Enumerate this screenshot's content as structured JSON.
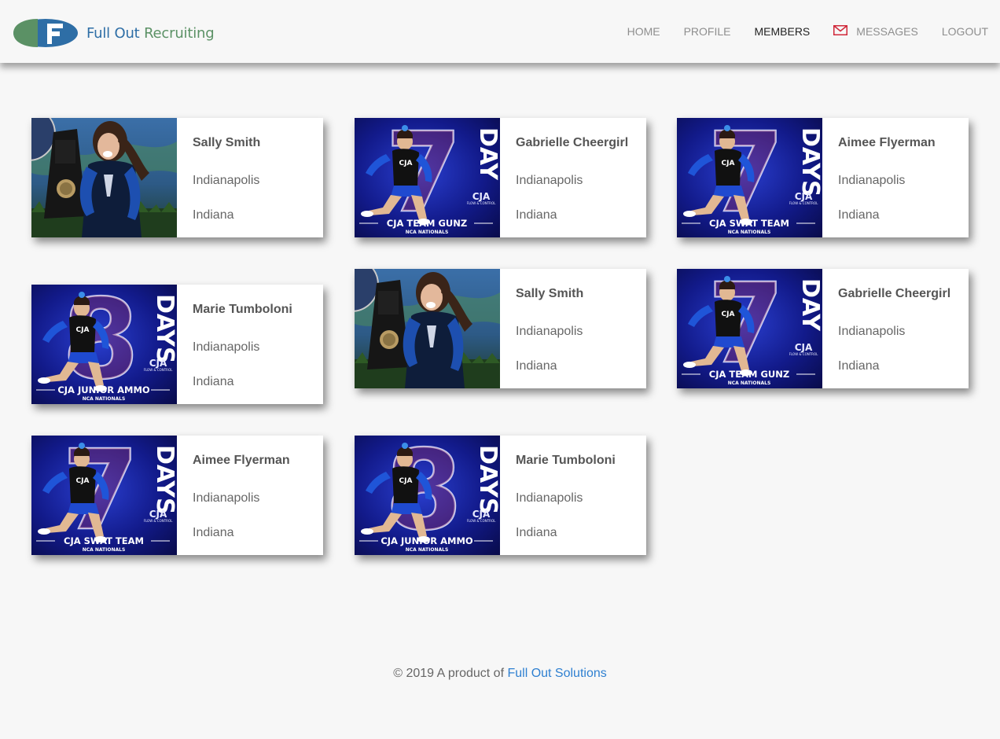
{
  "brand": {
    "name_part1": "Full Out ",
    "name_part2": "Recruiting",
    "colors": {
      "blue": "#2e6ea6",
      "green": "#5b9165"
    }
  },
  "nav": {
    "items": [
      {
        "label": "HOME",
        "active": false
      },
      {
        "label": "PROFILE",
        "active": false
      },
      {
        "label": "MEMBERS",
        "active": true
      },
      {
        "label": "MESSAGES",
        "active": false,
        "icon": "mail-icon"
      },
      {
        "label": "LOGOUT",
        "active": false
      }
    ]
  },
  "members": [
    {
      "name": "Sally Smith",
      "city": "Indianapolis",
      "state": "Indiana",
      "photo": "trophy"
    },
    {
      "name": "Gabrielle Cheergirl",
      "city": "Indianapolis",
      "state": "Indiana",
      "photo": "gunz",
      "banner_big": "DAY",
      "banner_team": "CJA TEAM GUNZ",
      "banner_sub": "NCA NATIONALS"
    },
    {
      "name": "Aimee Flyerman",
      "city": "Indianapolis",
      "state": "Indiana",
      "photo": "swat",
      "banner_big": "DAYS",
      "banner_team": "CJA SWAT TEAM",
      "banner_sub": "NCA NATIONALS"
    },
    {
      "name": "Marie Tumboloni",
      "city": "Indianapolis",
      "state": "Indiana",
      "photo": "ammo",
      "banner_big": "DAYS",
      "banner_team": "CJA JUNIOR AMMO",
      "banner_sub": "NCA NATIONALS"
    },
    {
      "name": "Sally Smith",
      "city": "Indianapolis",
      "state": "Indiana",
      "photo": "trophy"
    },
    {
      "name": "Gabrielle Cheergirl",
      "city": "Indianapolis",
      "state": "Indiana",
      "photo": "gunz",
      "banner_big": "DAY",
      "banner_team": "CJA TEAM GUNZ",
      "banner_sub": "NCA NATIONALS"
    },
    {
      "name": "Aimee Flyerman",
      "city": "Indianapolis",
      "state": "Indiana",
      "photo": "swat",
      "banner_big": "DAYS",
      "banner_team": "CJA SWAT TEAM",
      "banner_sub": "NCA NATIONALS"
    },
    {
      "name": "Marie Tumboloni",
      "city": "Indianapolis",
      "state": "Indiana",
      "photo": "ammo",
      "banner_big": "DAYS",
      "banner_team": "CJA JUNIOR AMMO",
      "banner_sub": "NCA NATIONALS"
    }
  ],
  "footer": {
    "text": "© 2019 A product of ",
    "link": "Full Out Solutions",
    "link_color": "#2f80d1"
  }
}
